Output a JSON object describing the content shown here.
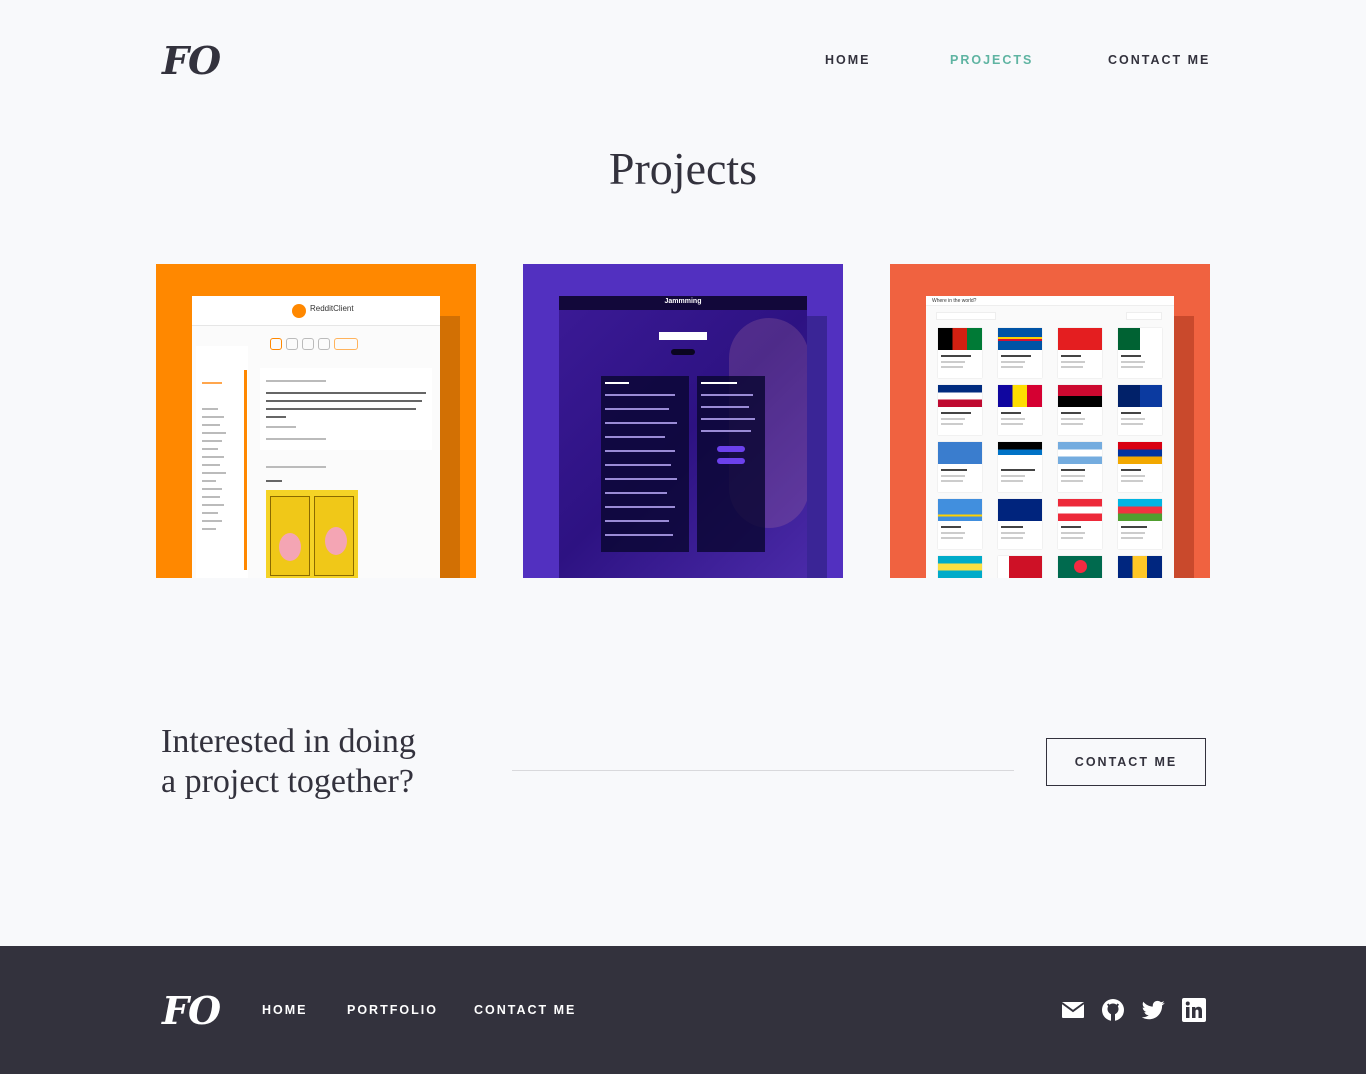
{
  "header": {
    "logo": "FO",
    "nav": [
      {
        "label": "HOME",
        "active": false
      },
      {
        "label": "PROJECTS",
        "active": true
      },
      {
        "label": "CONTACT ME",
        "active": false
      }
    ]
  },
  "main": {
    "title": "Projects",
    "projects": [
      {
        "background": "#ff8800",
        "screenshot_title": "RedditClient"
      },
      {
        "background": "#5230c0",
        "screenshot_title": "Jammming"
      },
      {
        "background": "#f06240",
        "screenshot_title": "Where in the world?"
      }
    ]
  },
  "cta": {
    "heading_line1": "Interested in doing",
    "heading_line2": "a project together?",
    "button_label": "CONTACT ME"
  },
  "footer": {
    "logo": "FO",
    "nav": [
      {
        "label": "HOME"
      },
      {
        "label": "PORTFOLIO"
      },
      {
        "label": "CONTACT ME"
      }
    ],
    "social_icons": [
      "email-icon",
      "github-icon",
      "twitter-icon",
      "linkedin-icon"
    ]
  },
  "colors": {
    "dark": "#33323d",
    "accent": "#5fb4a2",
    "background": "#f8f9fb"
  }
}
